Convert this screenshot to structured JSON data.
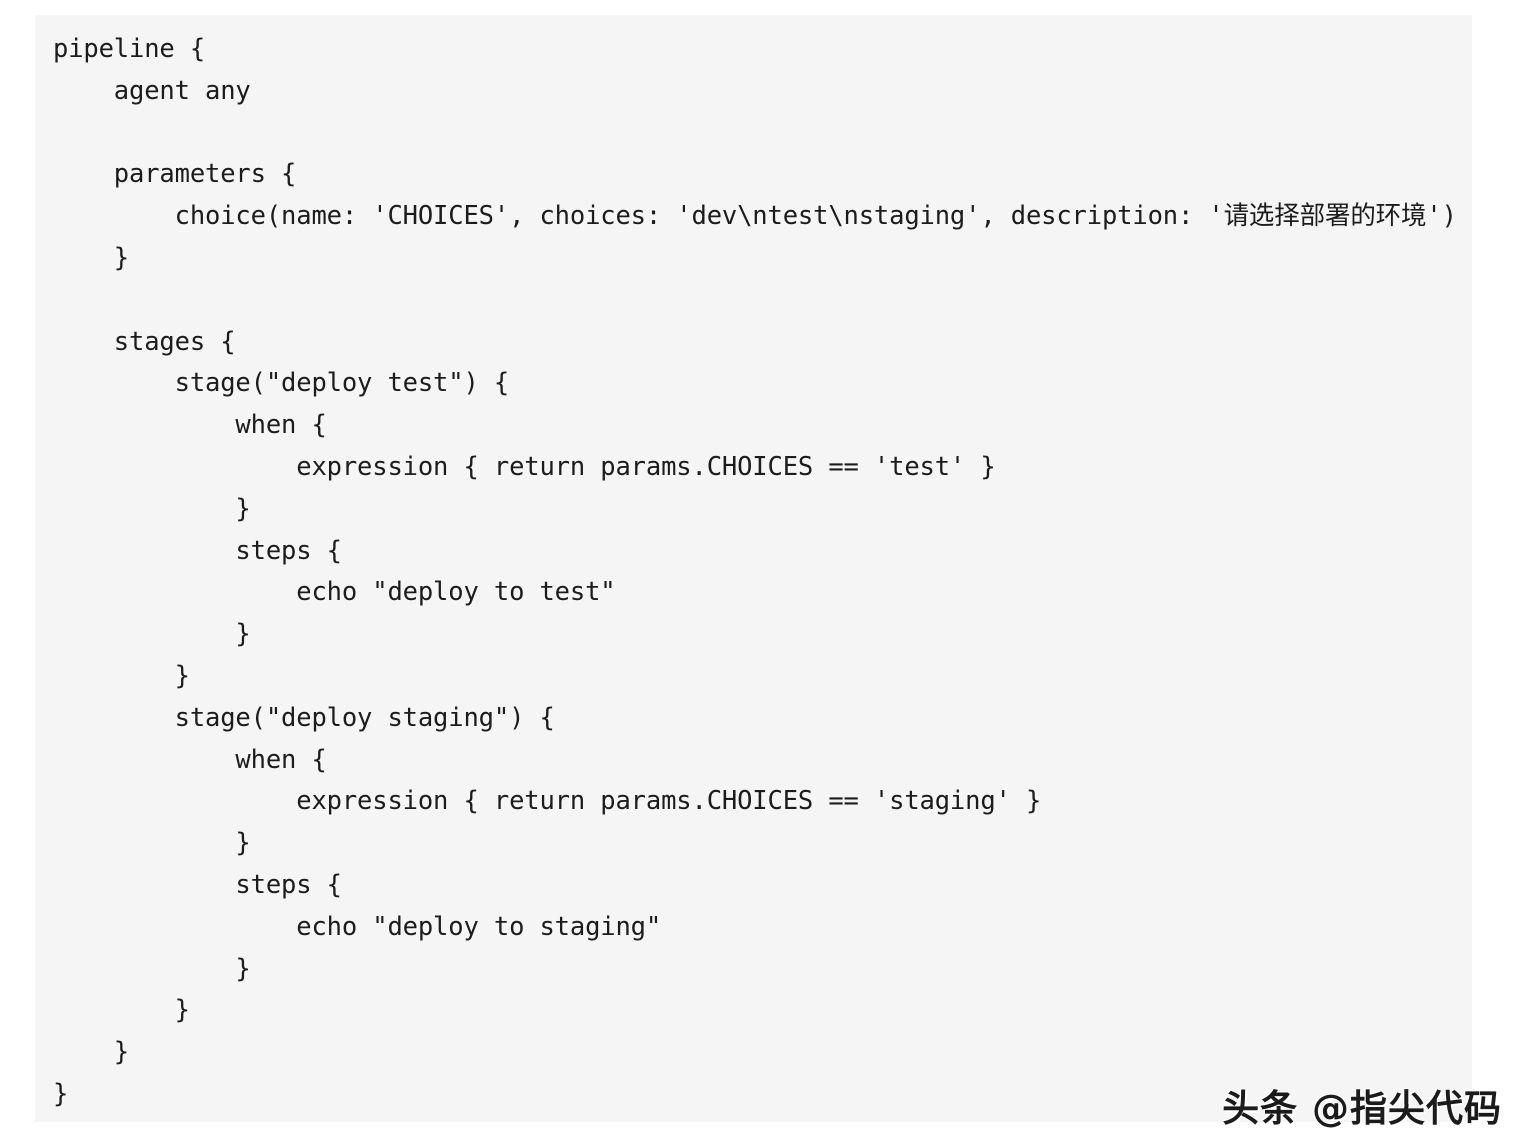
{
  "panel": {
    "background_color": "#f5f5f5",
    "text_color": "#1c1c1c",
    "language": "groovy"
  },
  "code": {
    "title": "Jenkins declarative pipeline with choice parameter",
    "lines": [
      "pipeline {",
      "    agent any",
      "",
      "    parameters {",
      "        choice(name: 'CHOICES', choices: 'dev\\ntest\\nstaging', description: '请选择部署的环境')",
      "    }",
      "",
      "    stages {",
      "        stage(\"deploy test\") {",
      "            when {",
      "                expression { return params.CHOICES == 'test' }",
      "            }",
      "            steps {",
      "                echo \"deploy to test\"",
      "            }",
      "        }",
      "        stage(\"deploy staging\") {",
      "            when {",
      "                expression { return params.CHOICES == 'staging' }",
      "            }",
      "            steps {",
      "                echo \"deploy to staging\"",
      "            }",
      "        }",
      "    }",
      "}"
    ]
  },
  "watermark": {
    "text": "头条 @指尖代码"
  }
}
